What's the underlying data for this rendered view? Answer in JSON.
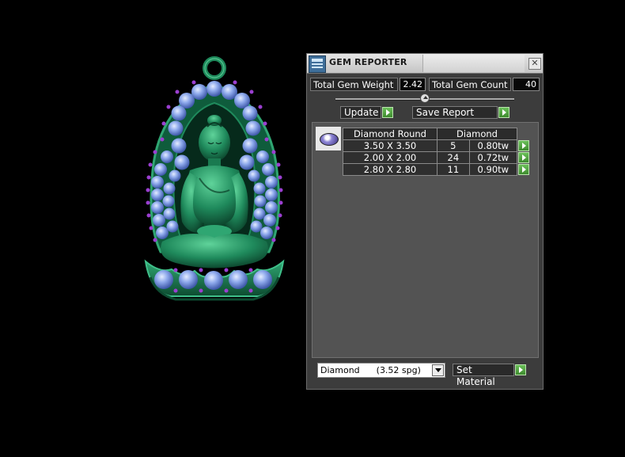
{
  "window": {
    "title": "GEM REPORTER",
    "close_glyph": "✕"
  },
  "stats": {
    "weight_label": "Total Gem Weight",
    "weight_value": "2.42",
    "count_label": "Total Gem Count",
    "count_value": "40"
  },
  "toolbar": {
    "update_label": "Update",
    "save_report_label": "Save Report"
  },
  "gem_table": {
    "headers": [
      "Diamond Round",
      "Diamond"
    ],
    "rows": [
      {
        "size": "3.50 X 3.50",
        "count": "5",
        "weight": "0.80tw"
      },
      {
        "size": "2.00 X 2.00",
        "count": "24",
        "weight": "0.72tw"
      },
      {
        "size": "2.80 X 2.80",
        "count": "11",
        "weight": "0.90tw"
      }
    ]
  },
  "material": {
    "selected": "Diamond      (3.52 spg)",
    "set_label": "Set Material"
  },
  "colors": {
    "metal": "#1f8a5c",
    "gem": "#7f9ee8",
    "accent_gem": "#9b3fd1",
    "button_green": "#4ea83c"
  },
  "icons": [
    "gem-reporter-app-icon",
    "close-icon",
    "slider-knob-icon",
    "play-arrow-icon",
    "dropdown-arrow-icon",
    "diamond-round-icon"
  ]
}
